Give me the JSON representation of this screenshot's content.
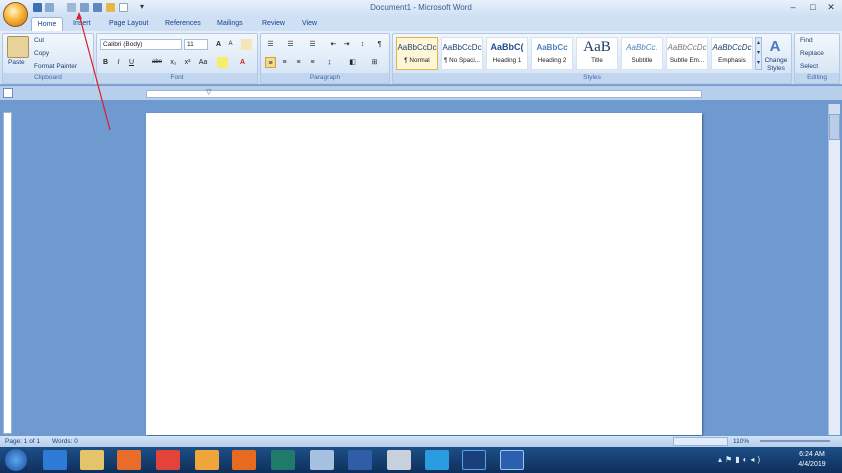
{
  "title_bar": {
    "title": "Document1 - Microsoft Word",
    "minimize": "–",
    "maximize": "□",
    "close": "✕"
  },
  "tabs": [
    "Home",
    "Insert",
    "Page Layout",
    "References",
    "Mailings",
    "Review",
    "View"
  ],
  "clipboard": {
    "paste": "Paste",
    "cut": "Cut",
    "copy": "Copy",
    "format_painter": "Format Painter",
    "label": "Clipboard"
  },
  "font": {
    "name": "Calibri (Body)",
    "size": "11",
    "label": "Font",
    "bold": "B",
    "italic": "I",
    "underline": "U",
    "strike": "abe",
    "sub": "x₂",
    "sup": "x²",
    "case": "Aa",
    "grow": "A",
    "shrink": "A"
  },
  "paragraph": {
    "label": "Paragraph",
    "pilcrow": "¶"
  },
  "styles": {
    "label": "Styles",
    "items": [
      {
        "preview": "AaBbCcDc",
        "name": "¶ Normal"
      },
      {
        "preview": "AaBbCcDc",
        "name": "¶ No Spaci..."
      },
      {
        "preview": "AaBbC(",
        "name": "Heading 1"
      },
      {
        "preview": "AaBbCc",
        "name": "Heading 2"
      },
      {
        "preview": "AaB",
        "name": "Title"
      },
      {
        "preview": "AaBbCc.",
        "name": "Subtitle"
      },
      {
        "preview": "AaBbCcDc",
        "name": "Subtle Em..."
      },
      {
        "preview": "AaBbCcDc",
        "name": "Emphasis"
      }
    ],
    "change_styles": "Change Styles"
  },
  "editing": {
    "label": "Editing",
    "find": "Find",
    "replace": "Replace",
    "select": "Select"
  },
  "status": {
    "page": "Page: 1 of 1",
    "words": "Words: 0",
    "zoom": "110%"
  },
  "clock": {
    "time": "6:24 AM",
    "date": "4/4/2019"
  },
  "colors": {
    "accent": "#15428b",
    "ribbon": "#c9dcf2",
    "taskbar": "#0e2f5c",
    "annotation": "#d6212a"
  }
}
